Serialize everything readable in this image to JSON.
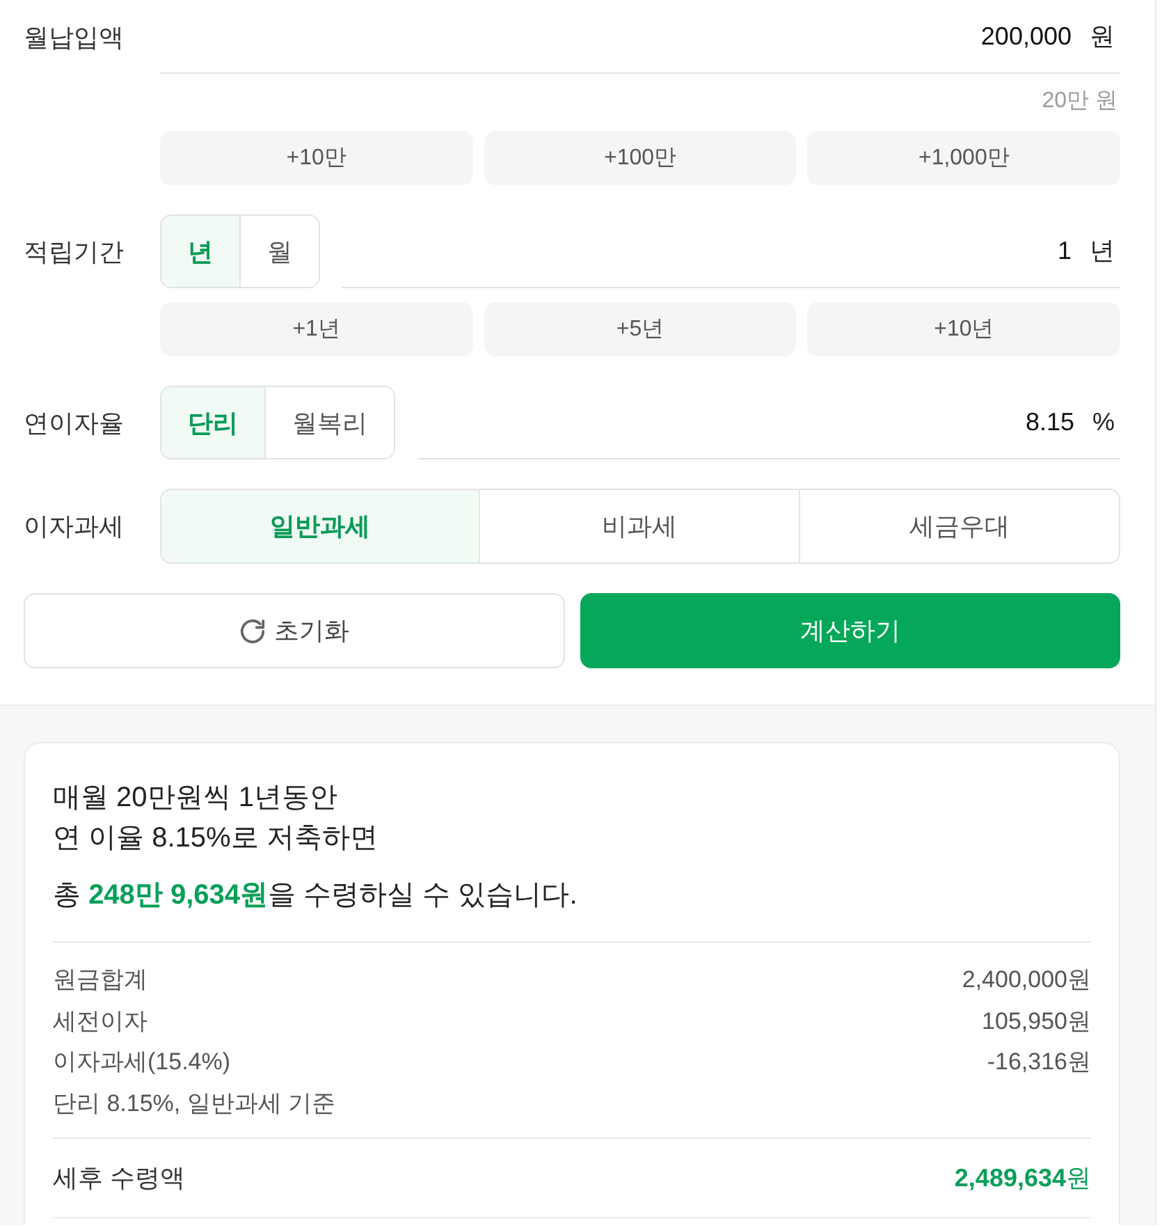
{
  "form": {
    "rows": [
      {
        "kind": "input",
        "label": "월납입액",
        "value": "200,000",
        "unit": "원",
        "hint": "20만 원",
        "quick_buttons": [
          "+10만",
          "+100만",
          "+1,000만"
        ]
      },
      {
        "kind": "input",
        "label": "적립기간",
        "toggle": [
          {
            "label": "년",
            "selected": true
          },
          {
            "label": "월",
            "selected": false
          }
        ],
        "value": "1",
        "unit": "년",
        "quick_buttons": [
          "+1년",
          "+5년",
          "+10년"
        ]
      },
      {
        "kind": "input",
        "label": "연이자율",
        "toggle": [
          {
            "label": "단리",
            "selected": true
          },
          {
            "label": "월복리",
            "selected": false
          }
        ],
        "value": "8.15",
        "unit": "%"
      },
      {
        "kind": "choice",
        "label": "이자과세",
        "options": [
          {
            "label": "일반과세",
            "selected": true
          },
          {
            "label": "비과세",
            "selected": false
          },
          {
            "label": "세금우대",
            "selected": false
          }
        ]
      }
    ],
    "reset_button": "초기화",
    "calculate_button": "계산하기"
  },
  "result": {
    "summary": [
      "매월 20만원씩 1년동안",
      "연 이율 8.15%로 저축하면"
    ],
    "total": "총 **248만 9,634원**을 수령하실 수 있습니다.",
    "details": [
      {
        "label": "원금합계",
        "value": "2,400,000원"
      },
      {
        "label": "세전이자",
        "value": "105,950원"
      },
      {
        "label": "이자과세(15.4%)",
        "value": "-16,316원"
      }
    ],
    "basis": "단리 8.15%, 일반과세 기준",
    "net": {
      "label": "세후 수령액",
      "value": "**2,489,634**원"
    }
  }
}
